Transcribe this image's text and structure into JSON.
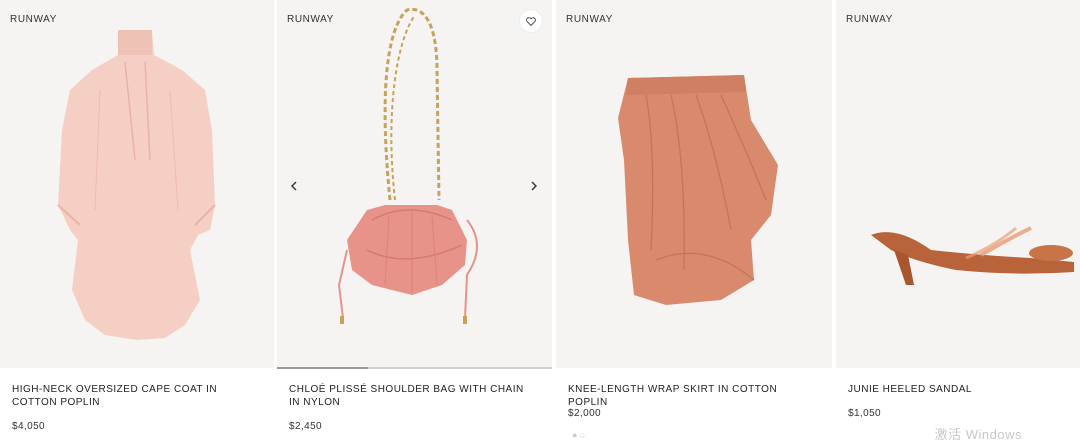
{
  "products": [
    {
      "badge": "RUNWAY",
      "title": "HIGH-NECK OVERSIZED CAPE COAT IN COTTON POPLIN",
      "price": "$4,050"
    },
    {
      "badge": "RUNWAY",
      "title": "CHLOÉ PLISSÉ SHOULDER BAG WITH CHAIN IN NYLON",
      "price": "$2,450",
      "carousel_progress": 0.33
    },
    {
      "badge": "RUNWAY",
      "title": "KNEE-LENGTH WRAP SKIRT IN COTTON POPLIN",
      "price": "$2,000"
    },
    {
      "badge": "RUNWAY",
      "title": "JUNIE HEELED SANDAL",
      "price": "$1,050"
    }
  ],
  "icons": {
    "wishlist": "heart-icon",
    "prev": "chevron-left-icon",
    "next": "chevron-right-icon"
  },
  "colors": {
    "image_bg": "#f5f4f3",
    "coat": "#f6cfc4",
    "bag": "#e8938a",
    "skirt": "#d98a6d",
    "sandal": "#b8633a",
    "gold": "#c8a15a"
  },
  "watermark": "激活 Windows"
}
